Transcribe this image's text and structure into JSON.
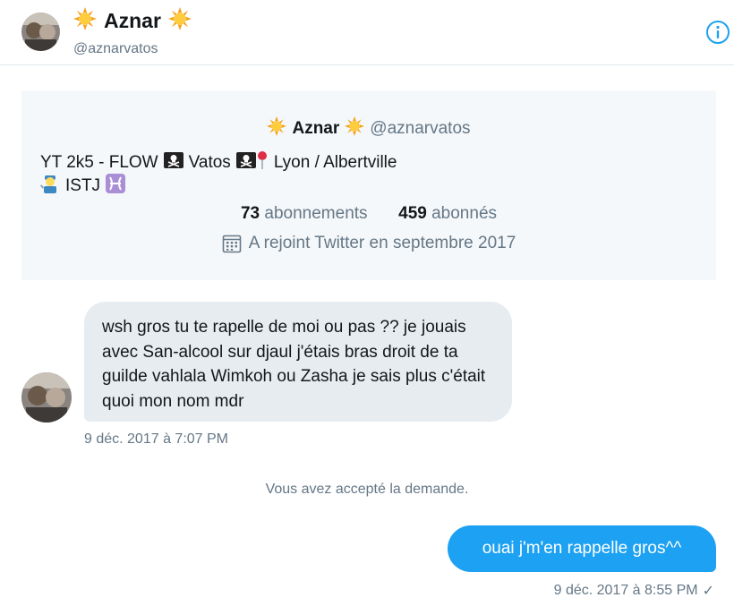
{
  "header": {
    "name": "Aznar",
    "handle": "@aznarvatos",
    "info_icon": "info-icon"
  },
  "profile_card": {
    "name": "Aznar",
    "handle": "@aznarvatos",
    "bio_line1_part1": "YT 2k5 - FLOW",
    "bio_line1_part2": "Vatos",
    "bio_line1_part3": "Lyon / Albertville",
    "bio_line2_text": "ISTJ",
    "following_count": "73",
    "following_label": "abonnements",
    "followers_count": "459",
    "followers_label": "abonnés",
    "joined": "A rejoint Twitter en septembre 2017"
  },
  "messages": {
    "incoming_text": "wsh gros tu te rapelle de moi ou pas ?? je jouais avec San-alcool sur djaul j'étais bras droit de ta guilde vahlala Wimkoh ou Zasha je sais plus c'était quoi mon nom mdr",
    "incoming_time": "9 déc. 2017 à 7:07 PM",
    "system_text": "Vous avez accepté la demande.",
    "outgoing_text": "ouai j'm'en rappelle gros^^",
    "outgoing_time": "9 déc. 2017 à 8:55 PM",
    "read_mark": "✓"
  },
  "colors": {
    "accent": "#1da1f2",
    "secondary_text": "#657786",
    "card_bg": "#f5f8fa",
    "incoming_bubble": "#e6ecf0"
  }
}
